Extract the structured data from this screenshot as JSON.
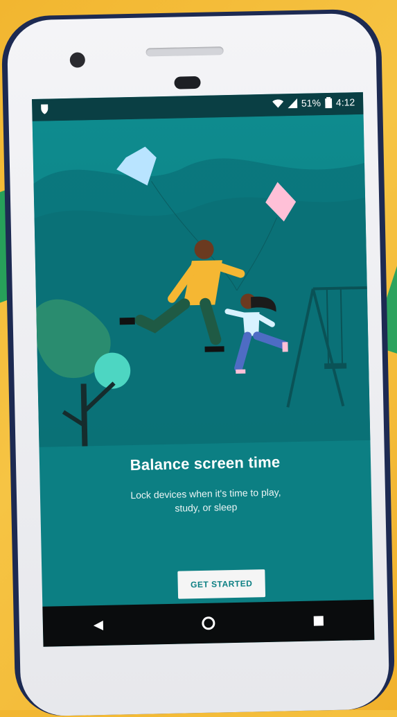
{
  "status_bar": {
    "battery_percent": "51%",
    "time": "4:12",
    "icons": [
      "app-icon",
      "wifi-icon",
      "signal-icon",
      "battery-icon"
    ]
  },
  "onboarding": {
    "title": "Balance screen time",
    "subtitle_line1": "Lock devices when it's time to play,",
    "subtitle_line2": "study, or sleep",
    "cta_label": "GET STARTED"
  },
  "nav": {
    "icons": [
      "back-icon",
      "home-icon",
      "recents-icon"
    ]
  },
  "colors": {
    "background": "#f2b630",
    "screen_teal": "#0c7f83",
    "status_bar": "#0a3f44",
    "nav_bar": "#0a0c0d"
  }
}
